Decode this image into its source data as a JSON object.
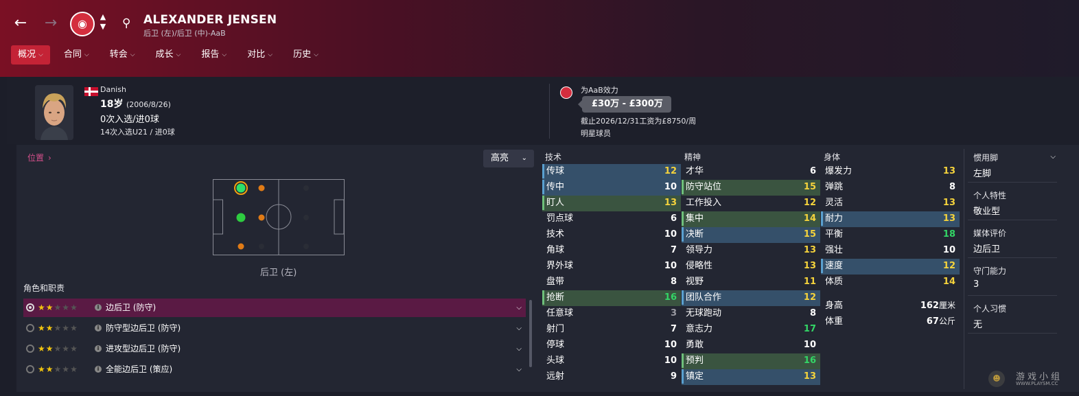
{
  "header": {
    "player_name": "ALEXANDER JENSEN",
    "positions_sub": "后卫 (左)/后卫 (中)-AaB",
    "club_crest_text": "AaB",
    "tabs": [
      {
        "label": "概况",
        "active": true
      },
      {
        "label": "合同"
      },
      {
        "label": "转会"
      },
      {
        "label": "成长"
      },
      {
        "label": "报告"
      },
      {
        "label": "对比"
      },
      {
        "label": "历史"
      }
    ]
  },
  "profile": {
    "nationality": "Danish",
    "age": "18岁",
    "dob": "(2006/8/26)",
    "caps": "0次入选/进0球",
    "u21_caps": "14次入选U21 / 进0球",
    "plays_for": "为AaB效力",
    "value": "£30万 - £300万",
    "contract": "截止2026/12/31工资为£8750/周",
    "status": "明星球员"
  },
  "position_panel": {
    "link": "位置",
    "highlight_option": "高亮",
    "pitch_label": "后卫 (左)",
    "roles_title": "角色和职责"
  },
  "roles": [
    {
      "label": "边后卫 (防守)",
      "stars": 2,
      "selected": true
    },
    {
      "label": "防守型边后卫 (防守)",
      "stars": 2,
      "selected": false
    },
    {
      "label": "进攻型边后卫 (防守)",
      "stars": 2,
      "selected": false
    },
    {
      "label": "全能边后卫 (策应)",
      "stars": 2,
      "selected": false
    }
  ],
  "attributes": {
    "technical": {
      "title": "技术",
      "items": [
        {
          "name": "传球",
          "value": "12",
          "hl": "blue",
          "color": "y"
        },
        {
          "name": "传中",
          "value": "10",
          "hl": "blue",
          "color": "w"
        },
        {
          "name": "盯人",
          "value": "13",
          "hl": "green",
          "color": "y"
        },
        {
          "name": "罚点球",
          "value": "6",
          "color": "w"
        },
        {
          "name": "技术",
          "value": "10",
          "color": "w"
        },
        {
          "name": "角球",
          "value": "7",
          "color": "w"
        },
        {
          "name": "界外球",
          "value": "10",
          "color": "w"
        },
        {
          "name": "盘带",
          "value": "8",
          "color": "w"
        },
        {
          "name": "抢断",
          "value": "16",
          "hl": "green",
          "color": "g"
        },
        {
          "name": "任意球",
          "value": "3",
          "color": "gray"
        },
        {
          "name": "射门",
          "value": "7",
          "color": "w"
        },
        {
          "name": "停球",
          "value": "10",
          "color": "w"
        },
        {
          "name": "头球",
          "value": "10",
          "color": "w"
        },
        {
          "name": "远射",
          "value": "9",
          "color": "w"
        }
      ]
    },
    "mental": {
      "title": "精神",
      "items": [
        {
          "name": "才华",
          "value": "6",
          "color": "w"
        },
        {
          "name": "防守站位",
          "value": "15",
          "hl": "green",
          "color": "y"
        },
        {
          "name": "工作投入",
          "value": "12",
          "color": "y"
        },
        {
          "name": "集中",
          "value": "14",
          "hl": "green",
          "color": "y"
        },
        {
          "name": "决断",
          "value": "15",
          "hl": "blue",
          "color": "y"
        },
        {
          "name": "领导力",
          "value": "13",
          "color": "y"
        },
        {
          "name": "侵略性",
          "value": "13",
          "color": "y"
        },
        {
          "name": "视野",
          "value": "11",
          "color": "y"
        },
        {
          "name": "团队合作",
          "value": "12",
          "hl": "blue",
          "color": "y"
        },
        {
          "name": "无球跑动",
          "value": "8",
          "color": "w"
        },
        {
          "name": "意志力",
          "value": "17",
          "color": "g"
        },
        {
          "name": "勇敢",
          "value": "10",
          "color": "w"
        },
        {
          "name": "预判",
          "value": "16",
          "hl": "green",
          "color": "g"
        },
        {
          "name": "镇定",
          "value": "13",
          "hl": "blue",
          "color": "y"
        }
      ]
    },
    "physical": {
      "title": "身体",
      "items": [
        {
          "name": "爆发力",
          "value": "13",
          "color": "y"
        },
        {
          "name": "弹跳",
          "value": "8",
          "color": "w"
        },
        {
          "name": "灵活",
          "value": "13",
          "color": "y"
        },
        {
          "name": "耐力",
          "value": "13",
          "hl": "blue",
          "color": "y"
        },
        {
          "name": "平衡",
          "value": "18",
          "color": "g"
        },
        {
          "name": "强壮",
          "value": "10",
          "color": "w"
        },
        {
          "name": "速度",
          "value": "12",
          "hl": "blue",
          "color": "y"
        },
        {
          "name": "体质",
          "value": "14",
          "color": "y"
        }
      ],
      "height_label": "身高",
      "height_value": "162",
      "height_unit": "厘米",
      "weight_label": "体重",
      "weight_value": "67",
      "weight_unit": "公斤"
    }
  },
  "side": [
    {
      "label": "惯用脚",
      "value": "左脚",
      "dropdown": true
    },
    {
      "label": "个人特性",
      "value": "敬业型"
    },
    {
      "label": "媒体评价",
      "value": "边后卫"
    },
    {
      "label": "守门能力",
      "value": "3"
    },
    {
      "label": "个人习惯",
      "value": "无"
    }
  ],
  "watermark": {
    "text": "游戏小组",
    "url": "WWW.PLAYSM.CC"
  },
  "colors": {
    "accent": "#c42336",
    "yellow_value": "#f5d33c",
    "green_value": "#33d666"
  }
}
